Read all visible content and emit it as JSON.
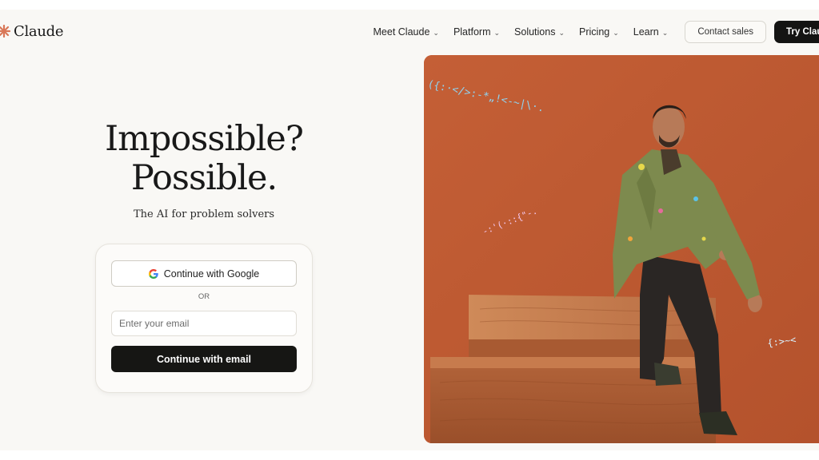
{
  "brand": {
    "name": "Claude",
    "logo_icon": "claude-starburst-icon",
    "accent_color": "#d97757"
  },
  "nav": {
    "items": [
      {
        "label": "Meet Claude",
        "icon": "chevron-down-icon"
      },
      {
        "label": "Platform",
        "icon": "chevron-down-icon"
      },
      {
        "label": "Solutions",
        "icon": "chevron-down-icon"
      },
      {
        "label": "Pricing",
        "icon": "chevron-down-icon"
      },
      {
        "label": "Learn",
        "icon": "chevron-down-icon"
      }
    ],
    "contact_label": "Contact sales",
    "try_label": "Try Claude"
  },
  "hero": {
    "title_line1": "Impossible?",
    "title_line2": "Possible.",
    "subtitle": "The AI for problem solvers"
  },
  "signin": {
    "google_label": "Continue with Google",
    "google_icon": "google-g-icon",
    "or_label": "OR",
    "email_placeholder": "Enter your email",
    "email_value": "",
    "email_button_label": "Continue with email"
  },
  "image": {
    "description_icon": "hero-photo",
    "background_color": "#bf5b33",
    "code_trail_left": "({:·</>:-*„!<-~|\\·.",
    "code_trail_mid": "-:'(·::{\"-.",
    "code_trail_right": "{:>~<"
  }
}
